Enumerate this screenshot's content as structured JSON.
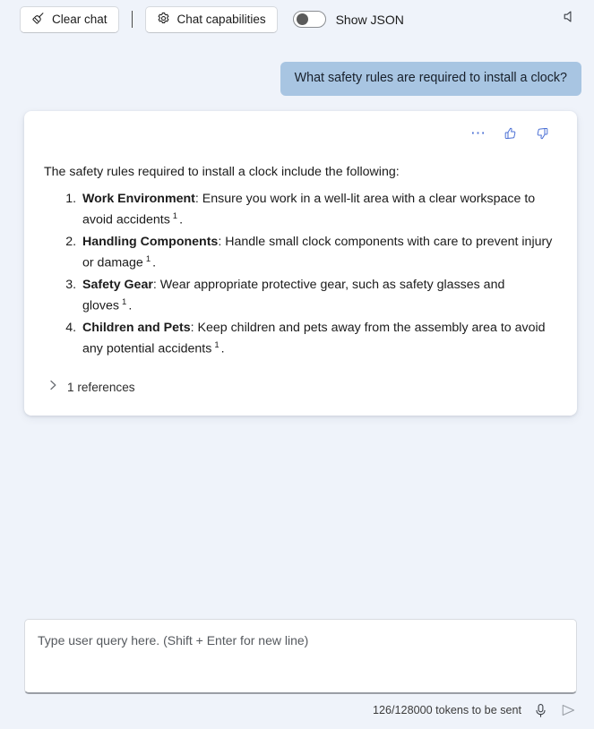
{
  "toolbar": {
    "clear_chat_label": "Clear chat",
    "clear_chat_icon": "broom-icon",
    "chat_capabilities_label": "Chat capabilities",
    "chat_capabilities_icon": "gear-icon",
    "show_json_label": "Show JSON",
    "show_json_state": "off",
    "speaker_icon": "speaker-mute-icon"
  },
  "conversation": {
    "user_message": "What safety rules are required to install a clock?",
    "assistant": {
      "actions": {
        "more_icon": "ellipsis-icon",
        "like_icon": "thumbs-up-icon",
        "dislike_icon": "thumbs-down-icon"
      },
      "intro": "The safety rules required to install a clock include the following:",
      "items": [
        {
          "term": "Work Environment",
          "text": ": Ensure you work in a well-lit area with a clear workspace to avoid accidents",
          "citation": "1",
          "tail": "."
        },
        {
          "term": "Handling Components",
          "text": ": Handle small clock components with care to prevent injury or damage",
          "citation": "1",
          "tail": "."
        },
        {
          "term": "Safety Gear",
          "text": ": Wear appropriate protective gear, such as safety glasses and gloves",
          "citation": "1",
          "tail": "."
        },
        {
          "term": "Children and Pets",
          "text": ": Keep children and pets away from the assembly area to avoid any potential accidents",
          "citation": "1",
          "tail": "."
        }
      ],
      "references_label": "1 references",
      "references_icon": "chevron-right-icon",
      "references_expanded": false
    }
  },
  "composer": {
    "placeholder": "Type user query here. (Shift + Enter for new line)",
    "value": "",
    "token_count": "126/128000 tokens to be sent",
    "mic_icon": "microphone-icon",
    "send_icon": "send-icon"
  },
  "colors": {
    "page_background": "#eff3fa",
    "card_background": "#ffffff",
    "user_bubble": "#a8c5e2",
    "accent_blue": "#4a6fd4",
    "text": "#1b1b1b"
  }
}
